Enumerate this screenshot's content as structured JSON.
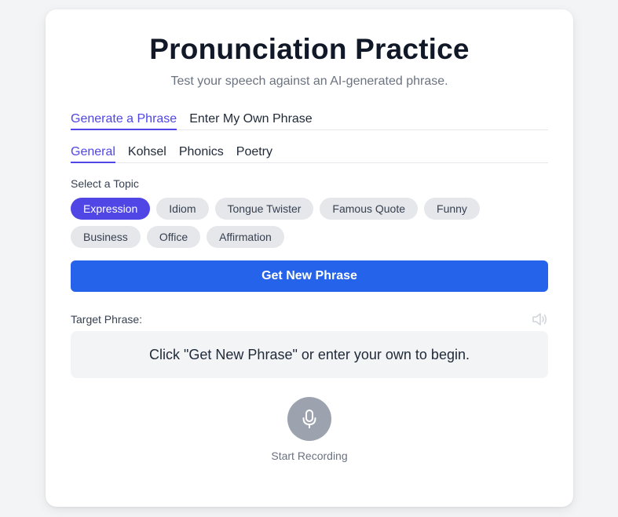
{
  "header": {
    "title": "Pronunciation Practice",
    "subtitle": "Test your speech against an AI-generated phrase."
  },
  "mode_tabs": [
    {
      "label": "Generate a Phrase",
      "active": true
    },
    {
      "label": "Enter My Own Phrase",
      "active": false
    }
  ],
  "category_tabs": [
    {
      "label": "General",
      "active": true
    },
    {
      "label": "Kohsel",
      "active": false
    },
    {
      "label": "Phonics",
      "active": false
    },
    {
      "label": "Poetry",
      "active": false
    }
  ],
  "topics": {
    "label": "Select a Topic",
    "items": [
      {
        "label": "Expression",
        "active": true
      },
      {
        "label": "Idiom",
        "active": false
      },
      {
        "label": "Tongue Twister",
        "active": false
      },
      {
        "label": "Famous Quote",
        "active": false
      },
      {
        "label": "Funny",
        "active": false
      },
      {
        "label": "Business",
        "active": false
      },
      {
        "label": "Office",
        "active": false
      },
      {
        "label": "Affirmation",
        "active": false
      }
    ]
  },
  "actions": {
    "get_phrase_label": "Get New Phrase"
  },
  "target": {
    "label": "Target Phrase:",
    "placeholder_text": "Click \"Get New Phrase\" or enter your own to begin.",
    "speaker_icon": "speaker-icon"
  },
  "recording": {
    "icon": "microphone-icon",
    "label": "Start Recording"
  },
  "colors": {
    "accent": "#4f46e5",
    "primary_button": "#2563eb",
    "mic_button": "#9ca3af",
    "pill_bg": "#e5e7eb"
  }
}
